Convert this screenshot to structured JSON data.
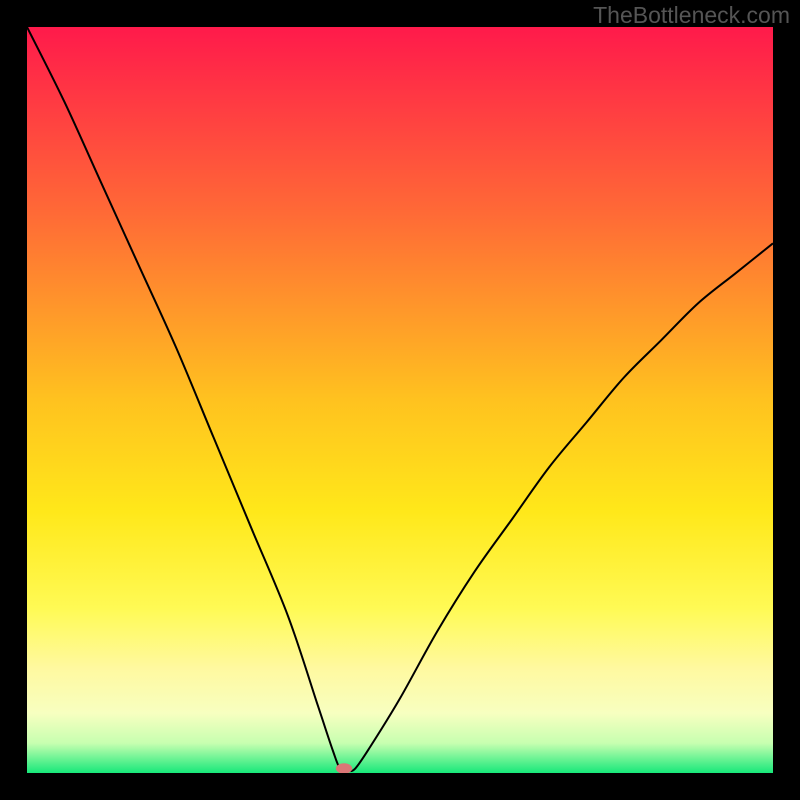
{
  "watermark": "TheBottleneck.com",
  "chart_data": {
    "type": "line",
    "title": "",
    "xlabel": "",
    "ylabel": "",
    "xlim": [
      0,
      100
    ],
    "ylim": [
      0,
      100
    ],
    "grid": false,
    "legend": false,
    "gradient_stops": [
      {
        "offset": 0.0,
        "color": "#ff1a4b"
      },
      {
        "offset": 0.25,
        "color": "#ff6a36"
      },
      {
        "offset": 0.5,
        "color": "#ffc21f"
      },
      {
        "offset": 0.65,
        "color": "#ffe81a"
      },
      {
        "offset": 0.78,
        "color": "#fffa55"
      },
      {
        "offset": 0.86,
        "color": "#fff9a0"
      },
      {
        "offset": 0.92,
        "color": "#f7ffc0"
      },
      {
        "offset": 0.96,
        "color": "#c7ffb0"
      },
      {
        "offset": 1.0,
        "color": "#17e87a"
      }
    ],
    "curve": {
      "description": "V-shaped bottleneck curve",
      "x": [
        0,
        5,
        10,
        15,
        20,
        25,
        30,
        35,
        39,
        41,
        42,
        43,
        44,
        46,
        50,
        55,
        60,
        65,
        70,
        75,
        80,
        85,
        90,
        95,
        100
      ],
      "y": [
        100,
        90,
        79,
        68,
        57,
        45,
        33,
        21,
        9,
        3,
        0.5,
        0.3,
        0.6,
        3.5,
        10,
        19,
        27,
        34,
        41,
        47,
        53,
        58,
        63,
        67,
        71
      ]
    },
    "marker": {
      "x": 42.5,
      "y": 0.6,
      "color": "#da7676"
    }
  }
}
